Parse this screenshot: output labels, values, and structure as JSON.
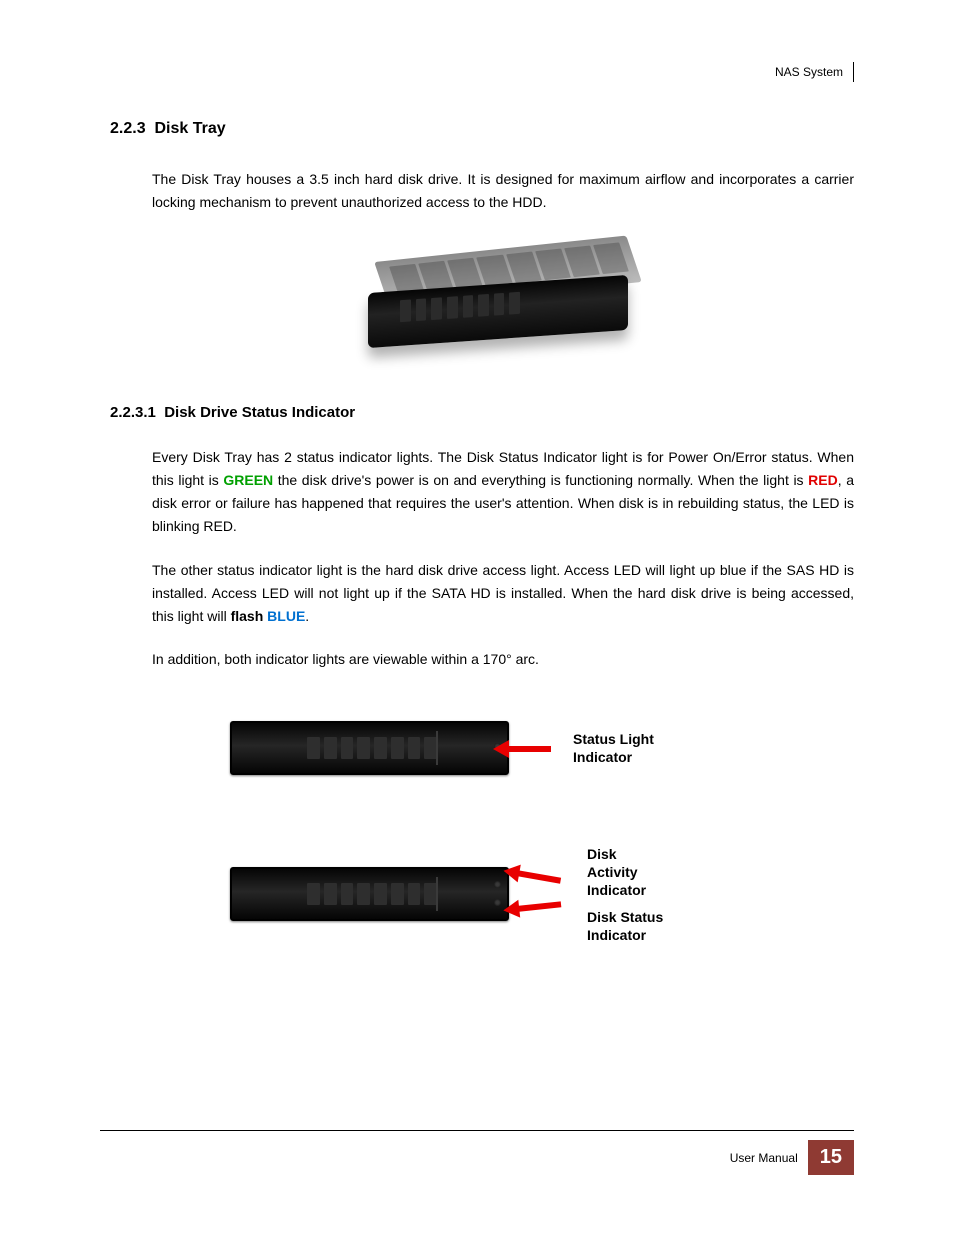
{
  "header": {
    "doc_title": "NAS System"
  },
  "sections": {
    "s1": {
      "number": "2.2.3",
      "title": "Disk Tray"
    },
    "s2": {
      "number": "2.2.3.1",
      "title": "Disk Drive Status Indicator"
    }
  },
  "body": {
    "p1": "The Disk Tray houses a 3.5 inch hard disk drive. It is designed for maximum airflow and incorporates a carrier locking mechanism to prevent unauthorized access to the HDD.",
    "p2a": "Every Disk Tray has 2 status indicator lights. The Disk Status Indicator light is for Power On/Error status. When this light is ",
    "p2_green": "GREEN",
    "p2b": " the disk drive's power is on and everything is functioning normally. When the light is ",
    "p2_red": "RED",
    "p2c": ", a disk error or failure has happened that requires the user's attention. When disk is in rebuilding status, the LED is blinking RED.",
    "p3a": "The other status indicator light is the hard disk drive access light. Access LED will light up blue if the SAS HD is installed. Access LED will not light up if the SATA HD is installed. When the hard disk drive is being accessed, this light will ",
    "p3_flash": "flash ",
    "p3_blue": "BLUE",
    "p3b": ".",
    "p4": "In addition, both indicator lights are viewable within a 170° arc."
  },
  "callouts": {
    "status_light_l1": "Status Light",
    "status_light_l2": "Indicator",
    "disk_activity_l1": "Disk",
    "disk_activity_l2": "Activity",
    "disk_activity_l3": "Indicator",
    "disk_status_l1": "Disk Status",
    "disk_status_l2": "Indicator"
  },
  "footer": {
    "label": "User Manual",
    "page": "15"
  }
}
